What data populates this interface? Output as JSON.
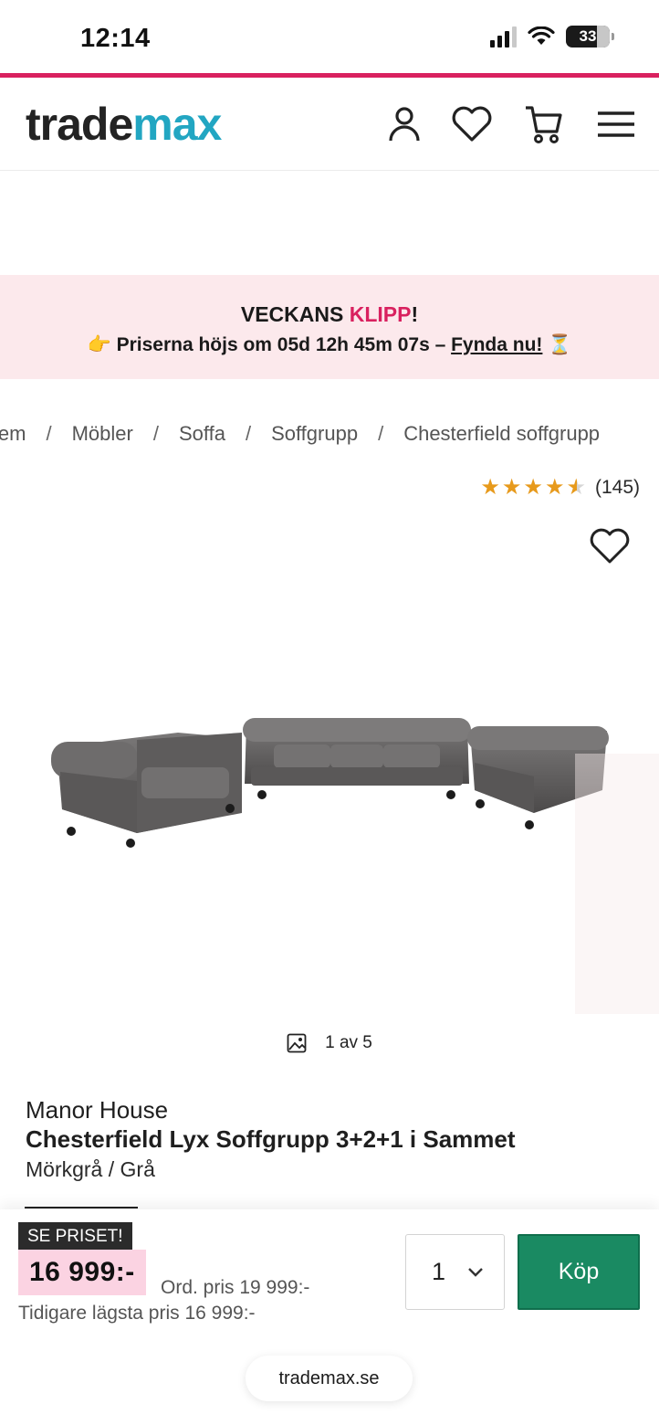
{
  "status_bar": {
    "time": "12:14",
    "battery": "33"
  },
  "header": {
    "logo_part1": "trade",
    "logo_part2": "max",
    "icons": [
      "account-icon",
      "heart-icon",
      "cart-icon",
      "menu-icon"
    ]
  },
  "promo": {
    "title_prefix": "VECKANS ",
    "title_accent": "KLIPP",
    "title_suffix": "!",
    "emoji_left": "👉",
    "countdown_text": "Priserna höjs om 05d 12h 45m 07s – ",
    "link": "Fynda nu!",
    "emoji_right": "⏳"
  },
  "breadcrumb": [
    "Hem",
    "Möbler",
    "Soffa",
    "Soffgrupp",
    "Chesterfield soffgrupp"
  ],
  "rating": {
    "stars": 4.5,
    "count": "(145)"
  },
  "gallery": {
    "counter": "1 av 5"
  },
  "product": {
    "brand": "Manor House",
    "title": "Chesterfield Lyx Soffgrupp 3+2+1 i Sammet",
    "variant": "Mörkgrå / Grå"
  },
  "purchase": {
    "badge": "SE PRISET!",
    "price": "16 999:-",
    "ordinary_price": "Ord. pris 19 999:-",
    "lowest_price": "Tidigare lägsta pris 16 999:-",
    "quantity": "1",
    "buy_label": "Köp"
  },
  "browser": {
    "url": "trademax.se"
  },
  "colors": {
    "accent_pink": "#d9215f",
    "logo_teal": "#22a6c2",
    "buy_green": "#1a8a62",
    "promo_bg": "#fce9ec",
    "star": "#e79a1c"
  }
}
